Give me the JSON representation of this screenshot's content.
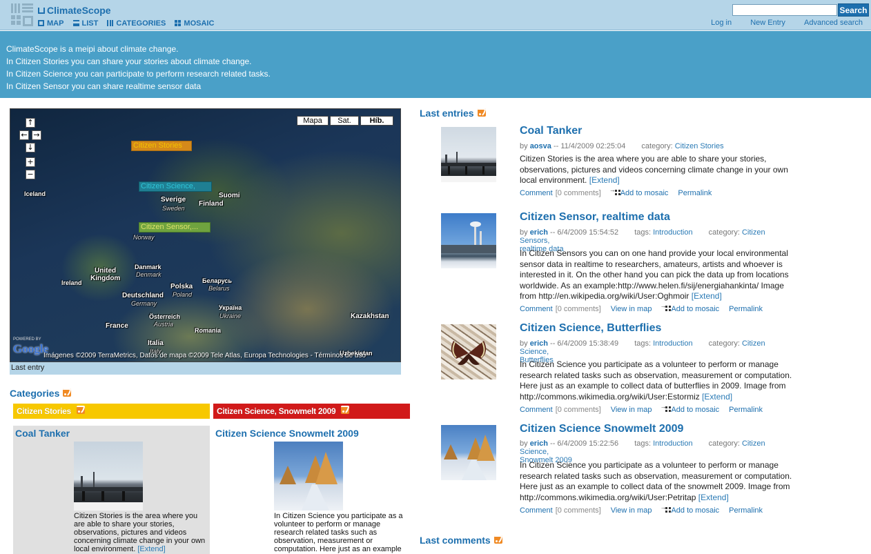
{
  "header": {
    "brand": "ClimateScope",
    "nav": [
      {
        "label": "MAP",
        "icon": "map-icon"
      },
      {
        "label": "LIST",
        "icon": "list-icon"
      },
      {
        "label": "CATEGORIES",
        "icon": "categories-icon"
      },
      {
        "label": "MOSAIC",
        "icon": "mosaic-icon"
      }
    ],
    "search_value": "",
    "search_button": "Search",
    "user_links": [
      "Log in",
      "New Entry",
      "Advanced search"
    ]
  },
  "intro": [
    "ClimateScope is a meipi about climate change.",
    "In Citizen Stories you can share your stories about climate change.",
    "In Citizen Science you can participate to perform research related tasks.",
    "In Citizen Sensor you can share realtime sensor data"
  ],
  "map": {
    "types": [
      "Mapa",
      "Sat.",
      "Híb."
    ],
    "markers": [
      "Citizen Stories",
      "Citizen Science,",
      "Citizen Sensor,..."
    ],
    "labels": {
      "iceland": "Iceland",
      "sverige": "Sverige",
      "sweden": "Sweden",
      "suomi": "Suomi",
      "finland": "Finland",
      "norway": "Norway",
      "danmark": "Danmark",
      "denmark": "Denmark",
      "uk1": "United",
      "uk2": "Kingdom",
      "ireland": "Ireland",
      "polska": "Polska",
      "poland": "Poland",
      "belarus1": "Беларусь",
      "belarus2": "Belarus",
      "deutschland": "Deutschland",
      "germany": "Germany",
      "ukraina1": "Україна",
      "ukraina2": "Ukraine",
      "oster": "Österreich",
      "austria": "Austria",
      "france": "France",
      "romania": "Romania",
      "kazakhstan": "Kazakhstan",
      "italia": "Italia",
      "italy": "Italy",
      "uzbek": "Uzbekistan"
    },
    "powered_by": "POWERED BY",
    "google": "Google",
    "copyright": "Imágenes ©2009 TerraMetrics, Datos de mapa ©2009 Tele Atlas, Europa Technologies - Términos de uso",
    "last_entry": "Last entry"
  },
  "categories": {
    "heading": "Categories",
    "bars": [
      "Citizen Stories",
      "Citizen Science, Snowmelt 2009"
    ],
    "bar_colors": [
      "#f7c800",
      "#d11a1a"
    ],
    "cols": [
      {
        "title": "Coal Tanker",
        "excerpt": "Citizen Stories is the area where you are able to share your stories, observations, pictures and videos concerning climate change in your own local environment.",
        "extend": "[Extend]"
      },
      {
        "title": "Citizen Science Snowmelt 2009",
        "excerpt": "In Citizen Science you participate as a volunteer to perform or manage research related tasks such as observation, measurement or computation. Here just as an example",
        "extend": ""
      }
    ]
  },
  "last_entries": {
    "heading": "Last entries",
    "entries": [
      {
        "title": "Coal Tanker",
        "by": "by",
        "user": "aosva",
        "date": "-- 11/4/2009 02:25:04",
        "tags_label": "",
        "tags": "",
        "category_label": "category:",
        "category": "Citizen Stories",
        "category2": "",
        "body": "Citizen Stories is the area where you are able to share your stories, observations, pictures and videos concerning climate change in your own local environment.",
        "extend": "[Extend]",
        "comment": "Comment",
        "comment_count": "[0 comments]",
        "view_in_map": "",
        "add_to_mosaic": "Add to mosaic",
        "permalink": "Permalink"
      },
      {
        "title": "Citizen Sensor, realtime data",
        "by": "by",
        "user": "erich",
        "date": "-- 6/4/2009 15:54:52",
        "tags_label": "tags:",
        "tags": "Introduction",
        "category_label": "category:",
        "category": "Citizen Sensors,",
        "category2": "realtime data",
        "body": "In Citizen Sensors you can on one hand provide your local environmental sensor data in realtime to researchers, amateurs, artists and whoever is interested in it. On the other hand you can pick the data up from locations worldwide. As an example:http://www.helen.fi/sij/energiahankinta/ Image from http://en.wikipedia.org/wiki/User:Oghmoir",
        "extend": "[Extend]",
        "comment": "Comment",
        "comment_count": "[0 comments]",
        "view_in_map": "View in map",
        "add_to_mosaic": "Add to mosaic",
        "permalink": "Permalink"
      },
      {
        "title": "Citizen Science, Butterflies",
        "by": "by",
        "user": "erich",
        "date": "-- 6/4/2009 15:38:49",
        "tags_label": "tags:",
        "tags": "Introduction",
        "category_label": "category:",
        "category": "Citizen Science,",
        "category2": "Butterflies",
        "body": "In Citizen Science you participate as a volunteer to perform or manage research related tasks such as observation, measurement or computation. Here just as an example to collect data of butterflies in 2009. Image from http://commons.wikimedia.org/wiki/User:Estormiz",
        "extend": "[Extend]",
        "comment": "Comment",
        "comment_count": "[0 comments]",
        "view_in_map": "View in map",
        "add_to_mosaic": "Add to mosaic",
        "permalink": "Permalink"
      },
      {
        "title": "Citizen Science Snowmelt 2009",
        "by": "by",
        "user": "erich",
        "date": "-- 6/4/2009 15:22:56",
        "tags_label": "tags:",
        "tags": "Introduction",
        "category_label": "category:",
        "category": "Citizen Science,",
        "category2": "Snowmelt 2009",
        "body": "In Citizen Science you participate as a volunteer to perform or manage research related tasks such as observation, measurement or computation. Here just as an example to collect data of the snowmelt 2009. Image from http://commons.wikimedia.org/wiki/User:Petritap",
        "extend": "[Extend]",
        "comment": "Comment",
        "comment_count": "[0 comments]",
        "view_in_map": "View in map",
        "add_to_mosaic": "Add to mosaic",
        "permalink": "Permalink"
      }
    ]
  },
  "last_comments": {
    "heading": "Last comments"
  },
  "colors": {
    "accent": "#1d6fae",
    "header_bg": "#b5d5e8",
    "intro_bg": "#4aa0c8",
    "rss": "#f08a24"
  }
}
